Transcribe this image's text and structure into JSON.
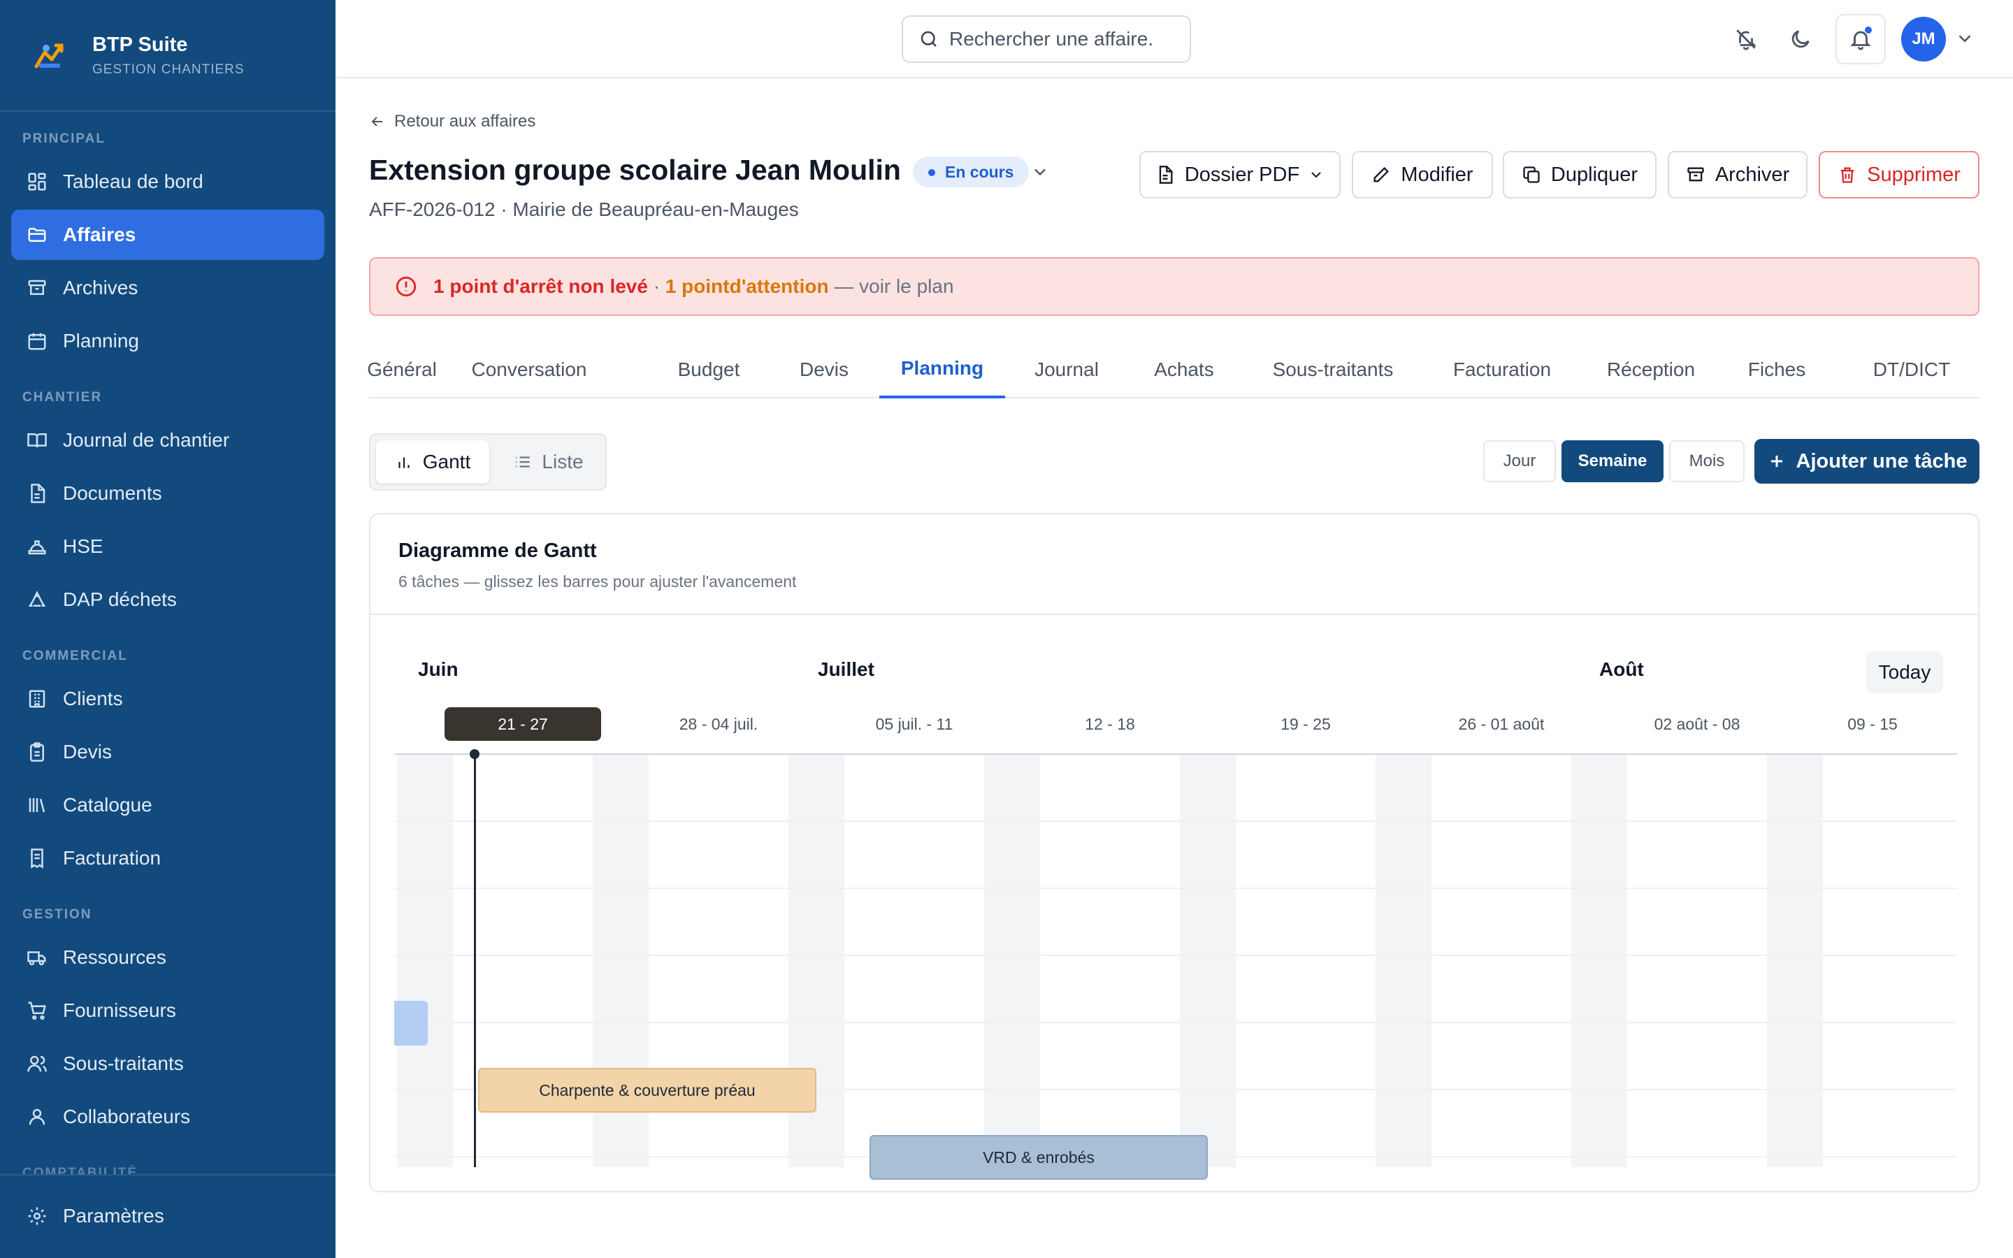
{
  "app": {
    "name": "BTP Suite",
    "tagline": "GESTION CHANTIERS"
  },
  "sidebar": {
    "sections": [
      {
        "title": "PRINCIPAL"
      },
      {
        "title": "CHANTIER"
      },
      {
        "title": "COMMERCIAL"
      },
      {
        "title": "GESTION"
      },
      {
        "title": "COMPTABILITÉ"
      }
    ],
    "items": [
      {
        "label": "Tableau de bord",
        "icon": "dashboard-icon"
      },
      {
        "label": "Affaires",
        "icon": "folder-icon",
        "active": true
      },
      {
        "label": "Archives",
        "icon": "archive-icon"
      },
      {
        "label": "Planning",
        "icon": "calendar-icon"
      },
      {
        "label": "Journal de chantier",
        "icon": "book-icon"
      },
      {
        "label": "Documents",
        "icon": "document-icon"
      },
      {
        "label": "HSE",
        "icon": "hardhat-icon"
      },
      {
        "label": "DAP déchets",
        "icon": "recycle-icon"
      },
      {
        "label": "Clients",
        "icon": "building-icon"
      },
      {
        "label": "Devis",
        "icon": "clipboard-icon"
      },
      {
        "label": "Catalogue",
        "icon": "library-icon"
      },
      {
        "label": "Facturation",
        "icon": "invoice-icon"
      },
      {
        "label": "Ressources",
        "icon": "truck-icon"
      },
      {
        "label": "Fournisseurs",
        "icon": "cart-icon"
      },
      {
        "label": "Sous-traitants",
        "icon": "users-icon"
      },
      {
        "label": "Collaborateurs",
        "icon": "user-icon"
      }
    ],
    "footer": {
      "label": "Paramètres",
      "icon": "gear-icon"
    }
  },
  "topbar": {
    "search_placeholder": "Rechercher une affaire.",
    "avatar_initials": "JM"
  },
  "header": {
    "back_label": "Retour aux affaires",
    "title": "Extension groupe scolaire Jean Moulin",
    "status": "En cours",
    "subtitle": "AFF-2026-012 · Mairie de Beaupréau-en-Mauges",
    "actions": {
      "pdf": "Dossier PDF",
      "edit": "Modifier",
      "duplicate": "Dupliquer",
      "archive": "Archiver",
      "delete": "Supprimer"
    }
  },
  "alert": {
    "part1": "1 point d'arrêt non levé",
    "sep": " · ",
    "part2": "1 pointd'attention",
    "part3": " — voir le plan"
  },
  "tabs": [
    "Général",
    "Conversation",
    "Budget",
    "Devis",
    "Planning",
    "Journal",
    "Achats",
    "Sous-traitants",
    "Facturation",
    "Réception",
    "Fiches",
    "DT/DICT"
  ],
  "active_tab": "Planning",
  "planning": {
    "view_gantt": "Gantt",
    "view_list": "Liste",
    "scale": {
      "day": "Jour",
      "week": "Semaine",
      "month": "Mois",
      "active": "Semaine"
    },
    "add_task": "Ajouter une tâche",
    "card_title": "Diagramme de Gantt",
    "card_subtitle": "6 tâches — glissez les barres pour ajuster l'avancement",
    "today_label": "Today",
    "months": [
      "Juin",
      "Juillet",
      "Août"
    ],
    "weeks": [
      "21 - 27",
      "28 - 04 juil.",
      "05 juil. - 11",
      "12 - 18",
      "19 - 25",
      "26 - 01 août",
      "02 août - 08",
      "09 - 15"
    ],
    "current_week": "21 - 27",
    "tasks": [
      {
        "label": "Charpente & couverture préau",
        "color": "#f3d3a8"
      },
      {
        "label": "VRD & enrobés",
        "color": "#a9bfd6"
      }
    ]
  },
  "colors": {
    "sidebar": "#124a7e",
    "accent": "#2563eb",
    "danger": "#dc2626",
    "warning": "#d97706"
  }
}
